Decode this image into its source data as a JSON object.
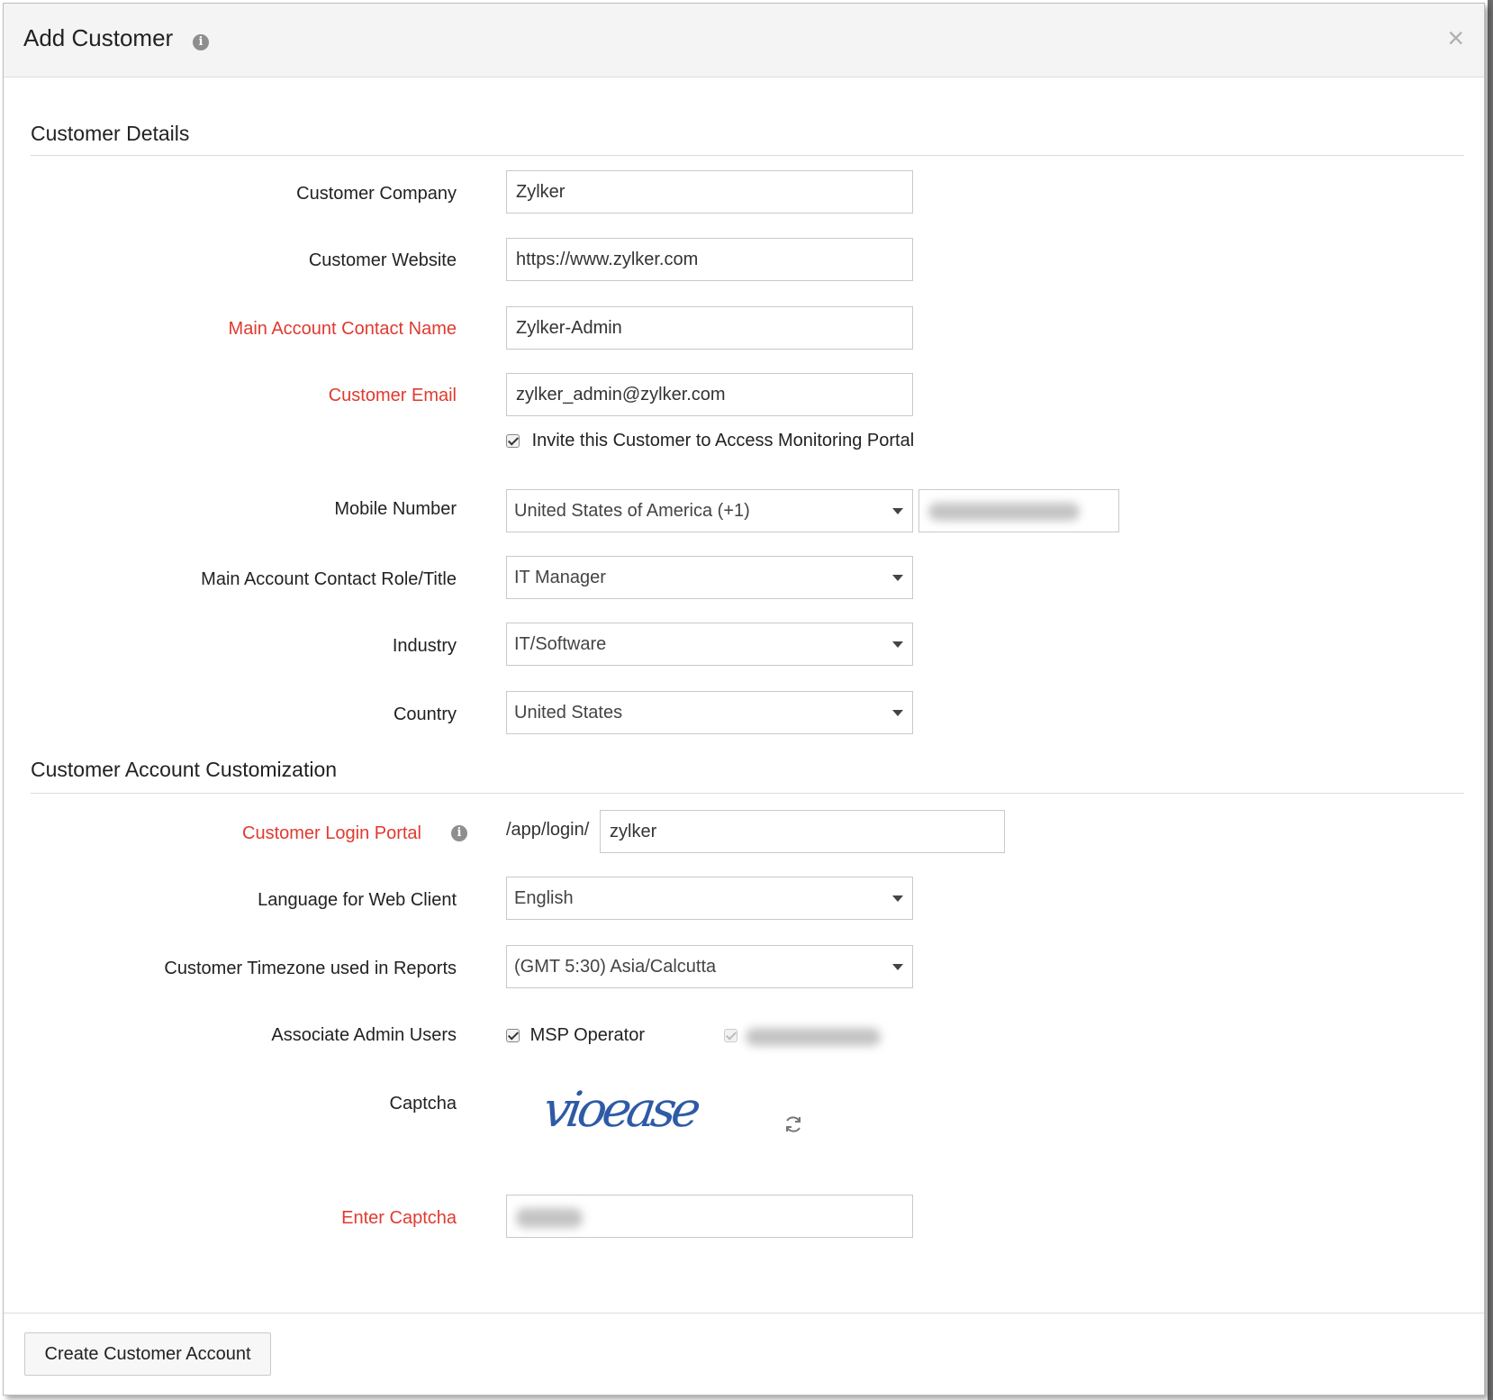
{
  "dialog": {
    "title": "Add Customer",
    "close_glyph": "×",
    "info_glyph": "i"
  },
  "sections": {
    "details": "Customer Details",
    "customization": "Customer Account Customization"
  },
  "fields": {
    "company": {
      "label": "Customer Company",
      "value": "Zylker",
      "required": false
    },
    "website": {
      "label": "Customer Website",
      "value": "https://www.zylker.com",
      "required": false
    },
    "contact_name": {
      "label": "Main Account Contact Name",
      "value": "Zylker-Admin",
      "required": true
    },
    "email": {
      "label": "Customer Email",
      "value": "zylker_admin@zylker.com",
      "required": true
    },
    "invite": {
      "label": "Invite this Customer to Access Monitoring Portal",
      "checked": true
    },
    "mobile": {
      "label": "Mobile Number",
      "country_code": "United States of America (+1)"
    },
    "role": {
      "label": "Main Account Contact Role/Title",
      "value": "IT Manager"
    },
    "industry": {
      "label": "Industry",
      "value": "IT/Software"
    },
    "country": {
      "label": "Country",
      "value": "United States"
    },
    "login_portal": {
      "label": "Customer Login Portal",
      "prefix": "/app/login/",
      "value": "zylker",
      "required": true
    },
    "language": {
      "label": "Language for Web Client",
      "value": "English"
    },
    "timezone": {
      "label": "Customer Timezone used in Reports",
      "value": "(GMT 5:30) Asia/Calcutta"
    },
    "admin_users": {
      "label": "Associate Admin Users",
      "option1": "MSP Operator",
      "option1_checked": true
    },
    "captcha": {
      "label": "Captcha",
      "text": "vioease"
    },
    "enter_captcha": {
      "label": "Enter Captcha",
      "required": true
    }
  },
  "footer": {
    "submit_label": "Create Customer Account"
  },
  "colors": {
    "required": "#e03a2f",
    "header_bg": "#f4f4f4",
    "captcha": "#2e5aa6"
  },
  "icons": {
    "info": "info-icon",
    "close": "close-icon",
    "caret": "chevron-down-icon",
    "refresh": "refresh-icon"
  }
}
